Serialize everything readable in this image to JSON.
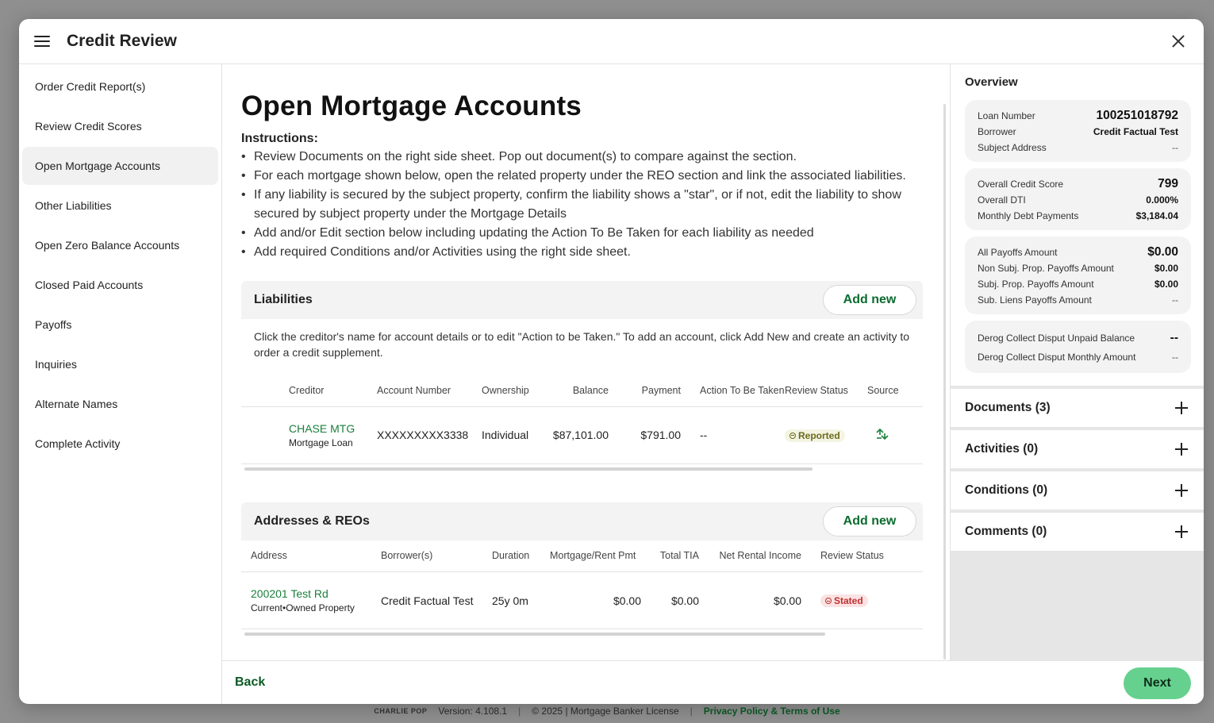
{
  "modal": {
    "title": "Credit Review"
  },
  "nav": {
    "items": [
      {
        "label": "Order Credit Report(s)"
      },
      {
        "label": "Review Credit Scores"
      },
      {
        "label": "Open Mortgage Accounts"
      },
      {
        "label": "Other Liabilities"
      },
      {
        "label": "Open Zero Balance Accounts"
      },
      {
        "label": "Closed Paid Accounts"
      },
      {
        "label": "Payoffs"
      },
      {
        "label": "Inquiries"
      },
      {
        "label": "Alternate Names"
      },
      {
        "label": "Complete Activity"
      }
    ],
    "active_index": 2
  },
  "main": {
    "title": "Open Mortgage Accounts",
    "instructions_title": "Instructions:",
    "instructions": [
      "Review Documents on the right side sheet. Pop out document(s) to compare against the section.",
      "For each mortgage shown below, open the related property under the REO section and link the associated liabilities.",
      "If any liability is secured by the subject property, confirm the liability shows a \"star\", or if not, edit the liability to show secured by subject property under the Mortgage Details",
      "Add and/or Edit section below including updating the Action To Be Taken for each liability as needed",
      "Add required Conditions and/or Activities using the right side sheet."
    ]
  },
  "liabilities": {
    "title": "Liabilities",
    "add_label": "Add new",
    "description": "Click the creditor's name for account details or to edit \"Action to be Taken.\" To add an account, click Add New and create an activity to order a credit supplement.",
    "columns": [
      "Creditor",
      "Account Number",
      "Ownership",
      "Balance",
      "Payment",
      "Action To Be Taken",
      "Review Status",
      "Source"
    ],
    "rows": [
      {
        "creditor": "CHASE MTG",
        "type": "Mortgage Loan",
        "account_number": "XXXXXXXXX3338",
        "ownership": "Individual",
        "balance": "$87,101.00",
        "payment": "$791.00",
        "action": "--",
        "status": "Reported",
        "source_icon": "credit-bureau-icon"
      }
    ]
  },
  "reos": {
    "title": "Addresses & REOs",
    "add_label": "Add new",
    "columns": [
      "Address",
      "Borrower(s)",
      "Duration",
      "Mortgage/Rent Pmt",
      "Total TIA",
      "Net Rental Income",
      "Review Status"
    ],
    "rows": [
      {
        "address": "200201 Test Rd",
        "address_sub": "Current•Owned Property",
        "borrowers": "Credit Factual Test",
        "duration": "25y 0m",
        "mortgage_rent_pmt": "$0.00",
        "total_tia": "$0.00",
        "net_rental_income": "$0.00",
        "status": "Stated"
      }
    ]
  },
  "overview": {
    "title": "Overview",
    "loan": {
      "loan_number_label": "Loan Number",
      "loan_number": "100251018792",
      "borrower_label": "Borrower",
      "borrower": "Credit Factual Test",
      "subject_address_label": "Subject Address",
      "subject_address": "--"
    },
    "credit": {
      "score_label": "Overall Credit Score",
      "score": "799",
      "dti_label": "Overall DTI",
      "dti": "0.000%",
      "mdp_label": "Monthly Debt Payments",
      "mdp": "$3,184.04"
    },
    "payoffs": {
      "all_label": "All Payoffs Amount",
      "all": "$0.00",
      "non_subj_label": "Non Subj. Prop. Payoffs Amount",
      "non_subj": "$0.00",
      "subj_label": "Subj. Prop. Payoffs Amount",
      "subj": "$0.00",
      "sub_liens_label": "Sub. Liens Payoffs Amount",
      "sub_liens": "--"
    },
    "derog": {
      "unpaid_label": "Derog Collect Disput Unpaid Balance",
      "unpaid": "--",
      "monthly_label": "Derog Collect Disput Monthly Amount",
      "monthly": "--"
    }
  },
  "accordions": [
    {
      "label": "Documents (3)"
    },
    {
      "label": "Activities (0)"
    },
    {
      "label": "Conditions (0)"
    },
    {
      "label": "Comments (0)"
    }
  ],
  "footer": {
    "back_label": "Back",
    "next_label": "Next"
  },
  "app_footer": {
    "logo": "CHARLIE POP",
    "version": "Version: 4.108.1",
    "copyright": "© 2025 | Mortgage Banker License",
    "privacy": "Privacy Policy & Terms of Use"
  }
}
